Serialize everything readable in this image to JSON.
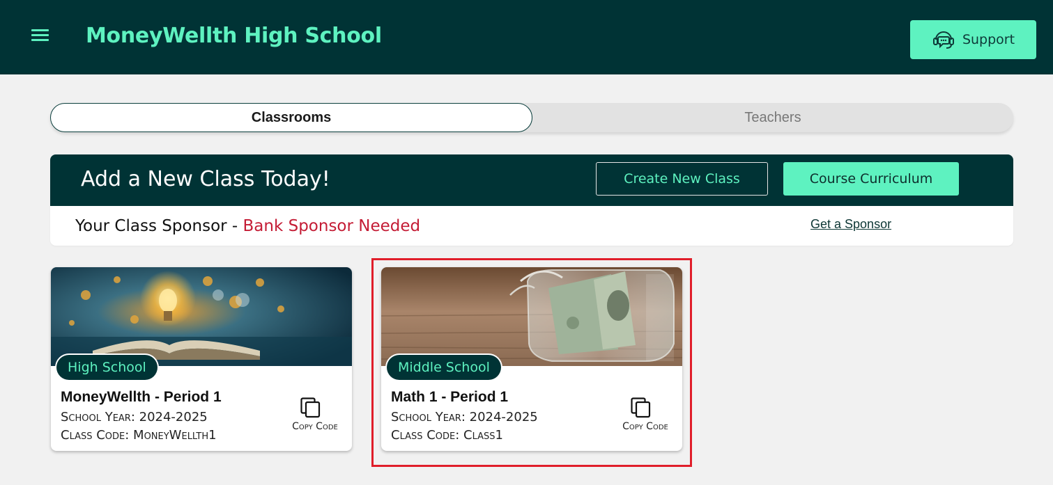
{
  "header": {
    "school_name": "MoneyWellth High School",
    "support_label": "Support",
    "menu_icon": "hamburger-menu-icon",
    "support_icon": "headset-chat-icon"
  },
  "tabs": [
    {
      "label": "Classrooms",
      "active": true
    },
    {
      "label": "Teachers",
      "active": false
    }
  ],
  "banner": {
    "title": "Add a New Class Today!",
    "create_label": "Create New Class",
    "curriculum_label": "Course Curriculum",
    "sponsor_prefix": "Your Class Sponsor - ",
    "sponsor_status": "Bank Sponsor Needed",
    "get_sponsor_label": "Get a Sponsor"
  },
  "classes": [
    {
      "level": "High School",
      "title": "MoneyWellth - Period 1",
      "school_year": "School Year: 2024-2025",
      "class_code": "Class Code: MoneyWellth1",
      "copy_label": "Copy Code",
      "image": "lightbulb-book-money-image"
    },
    {
      "level": "Middle School",
      "title": "Math 1 - Period 1",
      "school_year": "School Year: 2024-2025",
      "class_code": "Class Code: Class1",
      "copy_label": "Copy Code",
      "image": "money-jar-image"
    }
  ],
  "colors": {
    "primary_dark": "#003335",
    "accent_mint": "#5ef2c0",
    "alert_red": "#c41c35",
    "highlight_red": "#e01e2a"
  }
}
